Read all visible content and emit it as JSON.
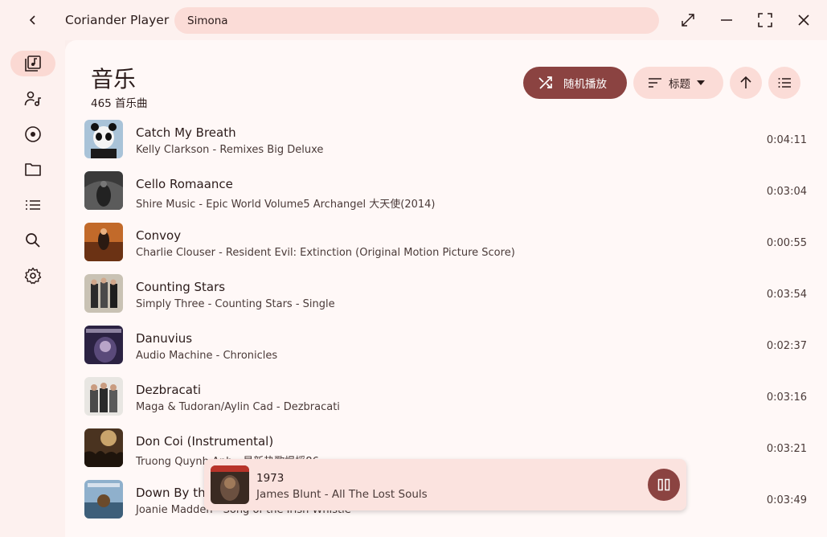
{
  "window": {
    "title": "Coriander Player",
    "search_value": "Simona",
    "search_placeholder": "",
    "icons": [
      "back-icon",
      "expand-icon",
      "minimize-icon",
      "maximize-icon",
      "close-icon"
    ]
  },
  "sidebar": {
    "items": [
      {
        "name": "music-library",
        "icon": "music-library-icon",
        "active": true
      },
      {
        "name": "artists",
        "icon": "artist-icon",
        "active": false
      },
      {
        "name": "albums",
        "icon": "album-icon",
        "active": false
      },
      {
        "name": "folders",
        "icon": "folder-icon",
        "active": false
      },
      {
        "name": "playlists",
        "icon": "list-icon",
        "active": false
      },
      {
        "name": "search",
        "icon": "search-icon",
        "active": false
      },
      {
        "name": "settings",
        "icon": "gear-icon",
        "active": false
      }
    ]
  },
  "header": {
    "title": "音乐",
    "count": "465 首乐曲",
    "shuffle_label": "随机播放",
    "sort_label": "标题"
  },
  "songs": [
    {
      "title": "Catch My Breath",
      "subtitle": "Kelly Clarkson - Remixes Big Deluxe",
      "duration": "0:04:11"
    },
    {
      "title": "Cello Romaance",
      "subtitle": "Shire Music - Epic World Volume5 Archangel 大天使(2014)",
      "duration": "0:03:04"
    },
    {
      "title": "Convoy",
      "subtitle": "Charlie Clouser - Resident Evil: Extinction (Original Motion Picture Score)",
      "duration": "0:00:55"
    },
    {
      "title": "Counting Stars",
      "subtitle": "Simply Three - Counting Stars - Single",
      "duration": "0:03:54"
    },
    {
      "title": "Danuvius",
      "subtitle": "Audio Machine - Chronicles",
      "duration": "0:02:37"
    },
    {
      "title": "Dezbracati",
      "subtitle": "Maga & Tudoran/Aylin Cad - Dezbracati",
      "duration": "0:03:16"
    },
    {
      "title": "Don Coi (Instrumental)",
      "subtitle": "Truong Quynh Anh - 最新热歌慢摇86",
      "duration": "0:03:21"
    },
    {
      "title": "Down By the",
      "subtitle": "Joanie Madden - Song of the Irish Whistle",
      "duration": "0:03:49"
    }
  ],
  "now_playing": {
    "title": "1973",
    "subtitle": "James Blunt - All The Lost Souls",
    "state": "playing"
  },
  "colors": {
    "accent": "#8b4341",
    "tonal": "#fbdcd7",
    "background": "#fff8f7"
  }
}
